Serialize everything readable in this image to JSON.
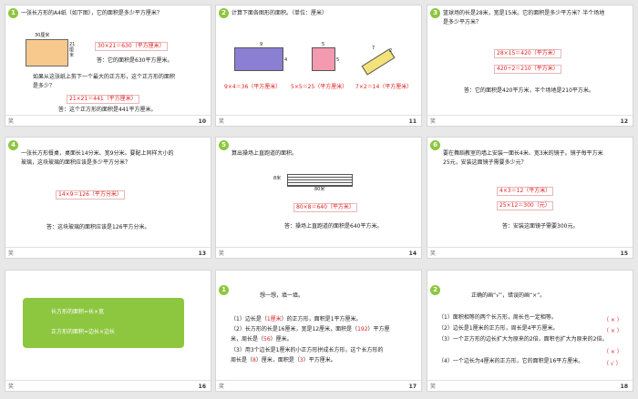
{
  "s10": {
    "num": "1",
    "footer_num": "10",
    "q1": "一张长方形的A4纸（如下图），它的面积是多少平方厘米？",
    "w": "30厘米",
    "h": "21厘米",
    "calc1": "30×21＝630（平方厘米）",
    "ans1": "答：它的面积是630平方厘米。",
    "q2": "如果从这张纸上剪下一个最大的正方形，这个正方形的面积",
    "q2b": "是多少？",
    "calc2": "21×21＝441（平方厘米）",
    "ans2": "答：这个正方形的面积是441平方厘米。"
  },
  "s11": {
    "num": "2",
    "footer_num": "11",
    "title": "计算下面各图形的面积。（单位：厘米）",
    "f1w": "9",
    "f1h": "4",
    "f2w": "5",
    "f2h": "5",
    "f3w": "7",
    "f3h": "2",
    "a1": "9×4＝36（平方厘米）",
    "a2": "5×5＝25（平方厘米）",
    "a3": "7×2＝14（平方厘米）"
  },
  "s12": {
    "num": "3",
    "footer_num": "12",
    "q": "篮球场的长是28米，宽是15米。它的面积是多少平方米？半个场地",
    "q2": "是多少平方米？",
    "c1": "28×15＝420（平方米）",
    "c2": "420÷2＝210（平方米）",
    "ans": "答：它的面积是420平方米，半个场地是210平方米。"
  },
  "s13": {
    "num": "4",
    "footer_num": "13",
    "q": "一张长方形餐桌，桌面长14分米、宽9分米。要配上同样大小的",
    "q2": "玻璃，这块玻璃的面积应该是多少平方分米？",
    "c": "14×9＝126（平方分米）",
    "ans": "答：这块玻璃的面积应该是126平方分米。"
  },
  "s14": {
    "num": "5",
    "footer_num": "14",
    "title": "算出操场上直跑道的面积。",
    "w": "80米",
    "h": "8米",
    "c": "80×8＝640（平方米）",
    "ans": "答：操场上直跑道的面积是640平方米。"
  },
  "s15": {
    "num": "6",
    "footer_num": "15",
    "q": "要在舞蹈教室的墙上安装一面长4米、宽3米的镜子。镜子每平方米",
    "q2": "25元，安装这面镜子需要多少元？",
    "c1": "4×3＝12（平方米）",
    "c2": "25×12＝300（元）",
    "ans": "答：安装这面镜子需要300元。"
  },
  "s16": {
    "footer_num": "16",
    "f1": "长方形的面积=长×宽",
    "f2": "正方形的面积=边长×边长"
  },
  "s17": {
    "num": "1",
    "footer_num": "17",
    "title": "想一想，填一填。",
    "l1a": "（1）边长是（",
    "l1r": "1厘米",
    "l1b": "）的正方形，面积是1平方厘米。",
    "l2a": "（2）长方形的长是16厘米，宽是12厘米，面积是（",
    "l2r": "192",
    "l2b": "）平方厘",
    "l2c": "米，周长是（",
    "l2r2": "56",
    "l2d": "）厘米。",
    "l3a": "（3）用3个边长是1厘米的小正方形拼成长方形，这个长方形的",
    "l3b": "周长是（",
    "l3r": "8",
    "l3c": "）厘米，面积是（",
    "l3r2": "3",
    "l3d": "）平方厘米。"
  },
  "s18": {
    "num": "2",
    "footer_num": "18",
    "title": "正确的画“√”，错误的画“×”。",
    "i1": "（1）面积相等的两个长方形，周长也一定相等。",
    "m1": "（ × ）",
    "i2": "（2）边长是1厘米的正方形，周长是4平方厘米。",
    "m2": "（ × ）",
    "i3": "（3）一个正方形的边长扩大为原来的2倍，面积也扩大为原来的2倍。",
    "m3": "（ × ）",
    "i4": "（4）一个边长为4厘米的正方形，它的面积是16平方厘米。",
    "m4": "（ √ ）"
  },
  "footer_left": "笑"
}
